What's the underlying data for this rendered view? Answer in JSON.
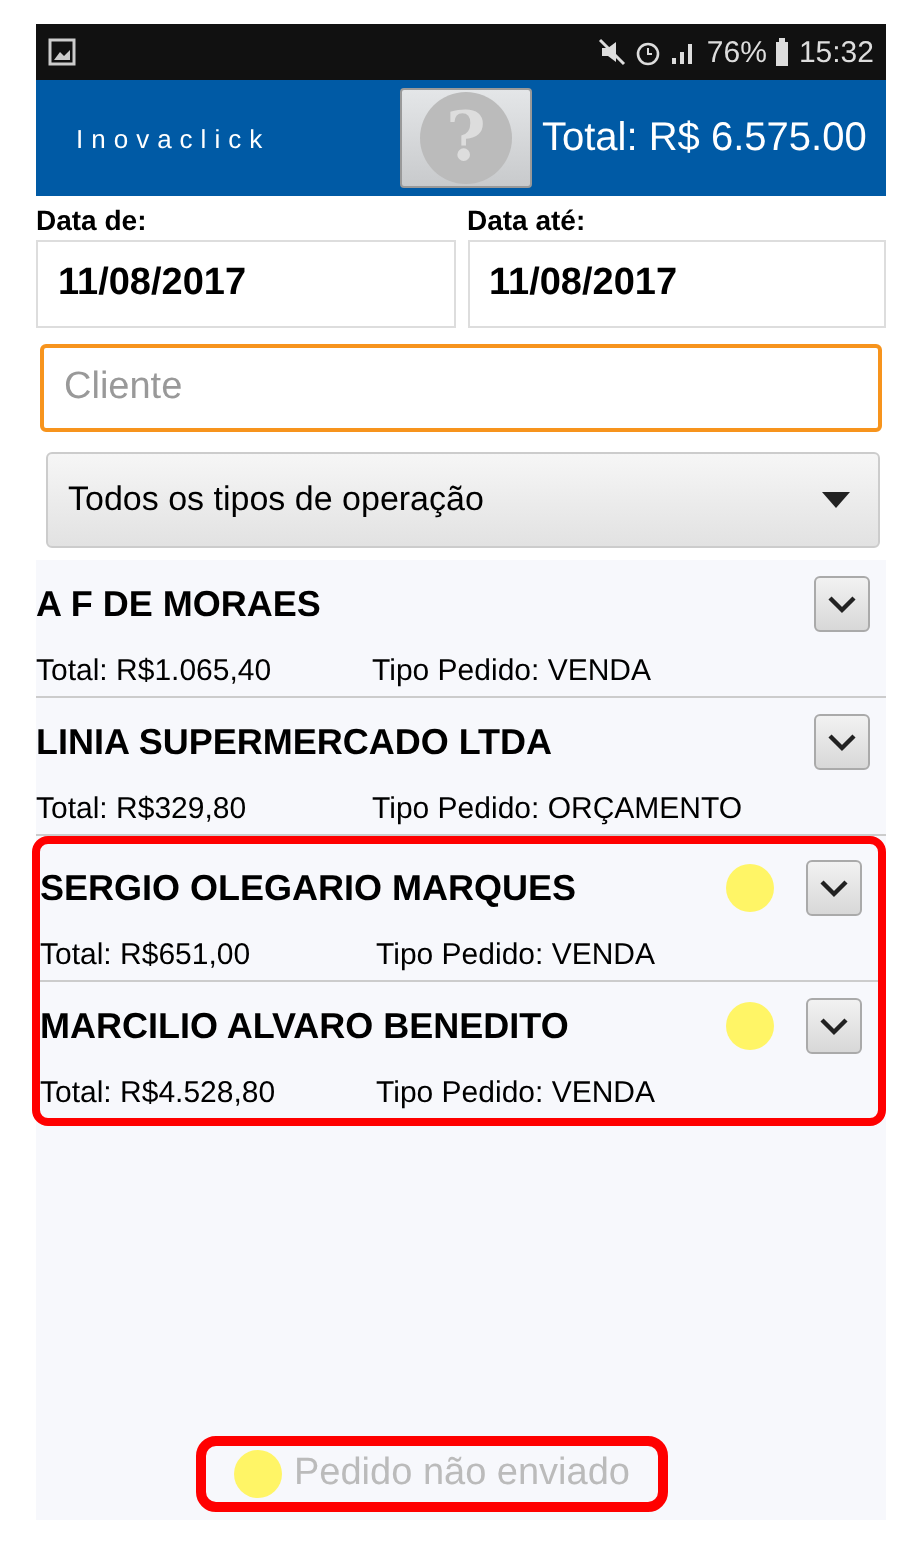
{
  "status_bar": {
    "battery": "76%",
    "time": "15:32"
  },
  "app_bar": {
    "title": "Inovaclick",
    "help_symbol": "?",
    "total": "Total: R$ 6.575.00"
  },
  "filters": {
    "date_from": {
      "label": "Data de:",
      "value": "11/08/2017"
    },
    "date_to": {
      "label": "Data até:",
      "value": "11/08/2017"
    },
    "client": {
      "placeholder": "Cliente"
    },
    "operation": {
      "value": "Todos os tipos de operação"
    }
  },
  "order_groups": [
    {
      "highlighted": false,
      "orders": [
        {
          "client": "A F DE MORAES",
          "total": "Total: R$1.065,40",
          "type": "Tipo Pedido: VENDA",
          "not_sent": false
        },
        {
          "client": "LINIA SUPERMERCADO LTDA",
          "total": "Total: R$329,80",
          "type": "Tipo Pedido: ORÇAMENTO",
          "not_sent": false
        }
      ]
    },
    {
      "highlighted": true,
      "orders": [
        {
          "client": "SERGIO OLEGARIO MARQUES",
          "total": "Total: R$651,00",
          "type": "Tipo Pedido: VENDA",
          "not_sent": true
        },
        {
          "client": "MARCILIO ALVARO BENEDITO",
          "total": "Total: R$4.528,80",
          "type": "Tipo Pedido: VENDA",
          "not_sent": true
        }
      ]
    }
  ],
  "legend": {
    "text": "Pedido não enviado",
    "color": "#fff566",
    "highlighted": true
  }
}
